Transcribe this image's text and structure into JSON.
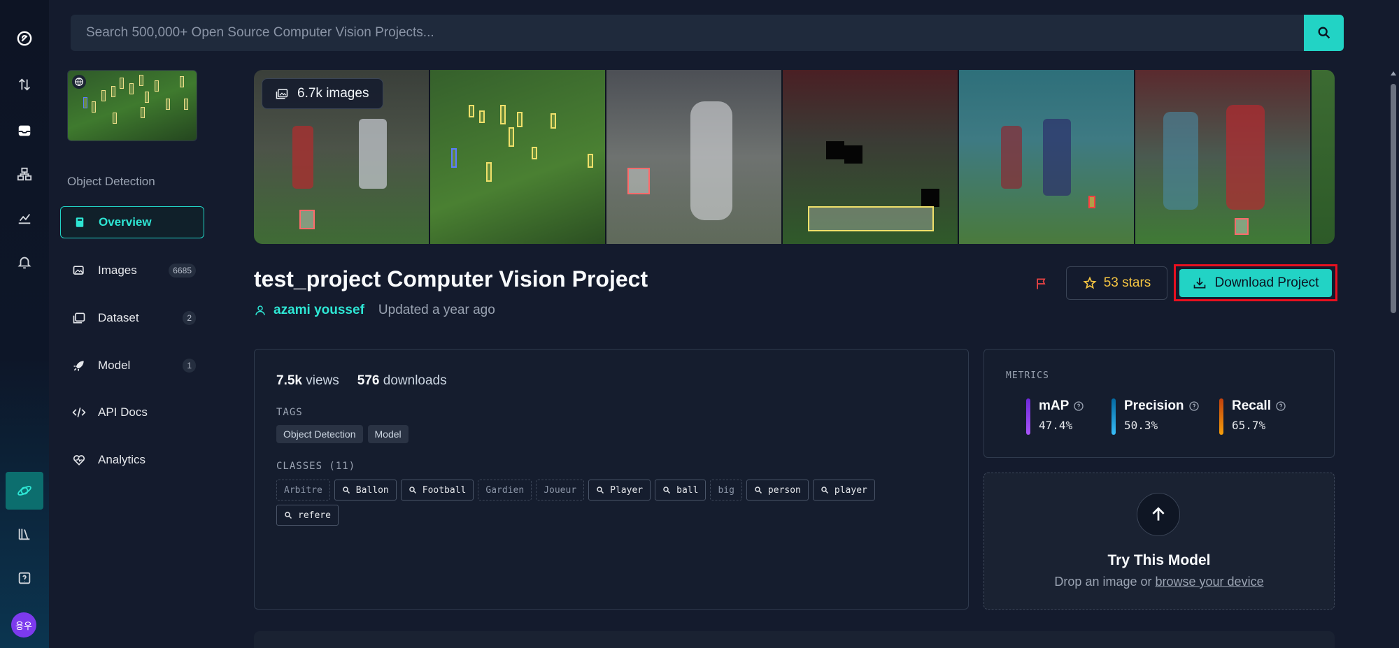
{
  "search": {
    "placeholder": "Search 500,000+ Open Source Computer Vision Projects..."
  },
  "rail": {
    "items": [
      "logo",
      "transfer",
      "inbox",
      "workflows",
      "analytics",
      "notifications",
      "universe",
      "library",
      "help"
    ],
    "avatar_initials": "용우"
  },
  "project_sidebar": {
    "type": "Object Detection",
    "items": [
      {
        "label": "Overview",
        "icon": "book-icon",
        "active": true
      },
      {
        "label": "Images",
        "icon": "images-icon",
        "badge": "6685"
      },
      {
        "label": "Dataset",
        "icon": "dataset-icon",
        "badge": "2"
      },
      {
        "label": "Model",
        "icon": "rocket-icon",
        "badge": "1"
      },
      {
        "label": "API Docs",
        "icon": "code-icon"
      },
      {
        "label": "Analytics",
        "icon": "heart-pulse-icon"
      }
    ]
  },
  "gallery": {
    "image_count": "6.7k images"
  },
  "project": {
    "title": "test_project Computer Vision Project",
    "author": "azami youssef",
    "updated": "Updated a year ago",
    "stars": "53 stars",
    "download_label": "Download Project"
  },
  "stats": {
    "views_num": "7.5k",
    "views_label": "views",
    "downloads_num": "576",
    "downloads_label": "downloads"
  },
  "tags_heading": "TAGS",
  "tags": [
    "Object Detection",
    "Model"
  ],
  "classes_heading": "CLASSES (11)",
  "classes": [
    {
      "name": "Arbitre",
      "searchable": false
    },
    {
      "name": "Ballon",
      "searchable": true
    },
    {
      "name": "Football",
      "searchable": true
    },
    {
      "name": "Gardien",
      "searchable": false
    },
    {
      "name": "Joueur",
      "searchable": false
    },
    {
      "name": "Player",
      "searchable": true
    },
    {
      "name": "ball",
      "searchable": true
    },
    {
      "name": "big",
      "searchable": false
    },
    {
      "name": "person",
      "searchable": true
    },
    {
      "name": "player",
      "searchable": true
    },
    {
      "name": "refere",
      "searchable": true
    }
  ],
  "metrics": {
    "heading": "METRICS",
    "items": [
      {
        "name": "mAP",
        "value": "47.4%",
        "color": "#a855f7"
      },
      {
        "name": "Precision",
        "value": "50.3%",
        "color": "#38bdf8"
      },
      {
        "name": "Recall",
        "value": "65.7%",
        "color": "#f59e0b"
      }
    ]
  },
  "try_model": {
    "title": "Try This Model",
    "subtitle_prefix": "Drop an image or ",
    "link": "browse your device"
  },
  "colors": {
    "accent": "#22d3c5",
    "highlight": "#e8101f",
    "stars": "#f5c542"
  }
}
